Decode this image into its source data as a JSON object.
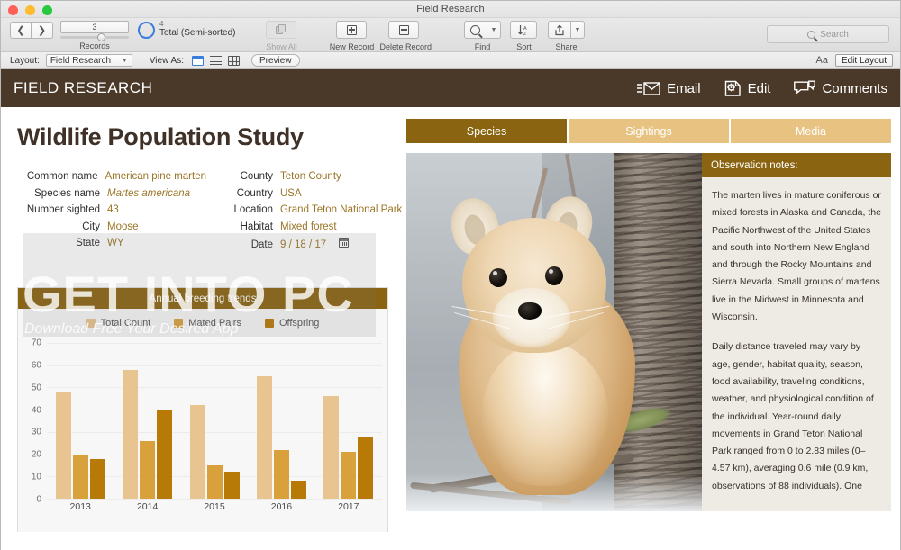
{
  "window": {
    "title": "Field Research"
  },
  "toolbar": {
    "prev_icon": "chevron-left-icon",
    "next_icon": "chevron-right-icon",
    "record_number": "3",
    "records_label": "Records",
    "total_count": "4",
    "total_label": "Total (Semi-sorted)",
    "show_all_label": "Show All",
    "new_record_label": "New Record",
    "delete_record_label": "Delete Record",
    "find_label": "Find",
    "sort_label": "Sort",
    "share_label": "Share",
    "search_placeholder": "Search"
  },
  "layoutbar": {
    "layout_label": "Layout:",
    "layout_value": "Field Research",
    "view_as_label": "View As:",
    "preview_label": "Preview",
    "text_format_icon": "Aa",
    "edit_layout_label": "Edit Layout"
  },
  "band": {
    "brand": "FIELD RESEARCH",
    "actions": [
      {
        "label": "Email",
        "icon": "envelope-icon"
      },
      {
        "label": "Edit",
        "icon": "gear-document-icon"
      },
      {
        "label": "Comments",
        "icon": "speech-bubbles-icon"
      }
    ]
  },
  "record": {
    "title": "Wildlife Population Study",
    "left_fields": [
      {
        "label": "Common name",
        "value": "American pine marten",
        "italic": false
      },
      {
        "label": "Species name",
        "value": "Martes americana",
        "italic": true
      },
      {
        "label": "Number sighted",
        "value": "43",
        "italic": false
      },
      {
        "label": "City",
        "value": "Moose",
        "italic": false
      },
      {
        "label": "State",
        "value": "WY",
        "italic": false
      }
    ],
    "right_fields": [
      {
        "label": "County",
        "value": "Teton County"
      },
      {
        "label": "Country",
        "value": "USA"
      },
      {
        "label": "Location",
        "value": "Grand Teton National Park"
      },
      {
        "label": "Habitat",
        "value": "Mixed forest"
      },
      {
        "label": "Date",
        "value": "9 / 18 / 17"
      }
    ]
  },
  "tabs": [
    {
      "label": "Species",
      "active": true
    },
    {
      "label": "Sightings",
      "active": false
    },
    {
      "label": "Media",
      "active": false
    }
  ],
  "photo": {
    "alt": "american-pine-marten-photo"
  },
  "notes": {
    "header": "Observation notes:",
    "paragraphs": [
      "The marten lives in mature coniferous or mixed forests in Alaska and Canada, the Pacific Northwest of the United States and south into Northern New England and through the Rocky Mountains and Sierra Nevada. Small groups of martens live in the Midwest in Minnesota and Wisconsin.",
      "Daily distance traveled may vary by age, gender, habitat quality, season, food availability, traveling conditions, weather, and physiological condition of the individual. Year-round daily movements in Grand Teton National Park ranged from 0 to 2.83 miles (0–4.57 km), averaging 0.6 mile (0.9 km, observations of 88 individuals). One"
    ]
  },
  "watermark": {
    "big": "GET INTO PC",
    "sub": "Download Free Your Desired App"
  },
  "colors": {
    "brand_brown": "#4a3828",
    "accent_gold": "#8a6410",
    "tab_inactive": "#e7c281",
    "field_value": "#9b7527",
    "series_total": "#e8c491",
    "series_mated": "#d8a13c",
    "series_offspring": "#b87a06"
  },
  "chart_data": {
    "type": "bar",
    "title": "Annual breeding trends",
    "xlabel": "",
    "ylabel": "",
    "ylim": [
      0,
      70
    ],
    "yticks": [
      0,
      10,
      20,
      30,
      40,
      50,
      60,
      70
    ],
    "grid": true,
    "legend_position": "top",
    "categories": [
      "2013",
      "2014",
      "2015",
      "2016",
      "2017"
    ],
    "series": [
      {
        "name": "Total Count",
        "color": "#e8c491",
        "values": [
          48,
          58,
          42,
          55,
          46
        ]
      },
      {
        "name": "Mated Pairs",
        "color": "#d8a13c",
        "values": [
          20,
          26,
          15,
          22,
          21
        ]
      },
      {
        "name": "Offspring",
        "color": "#b87a06",
        "values": [
          18,
          40,
          12,
          8,
          28
        ]
      }
    ]
  }
}
